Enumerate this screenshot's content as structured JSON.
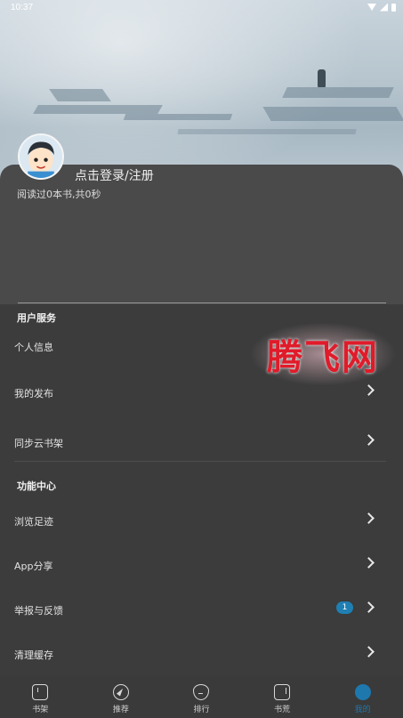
{
  "status_bar": {
    "time": "10:37"
  },
  "profile": {
    "login_label": "点击登录/注册",
    "read_stats": "阅读过0本书,共0秒"
  },
  "sections": {
    "user_services": {
      "title": "用户服务",
      "items": [
        {
          "label": "个人信息",
          "chevron": false
        },
        {
          "label": "我的发布",
          "chevron": true
        },
        {
          "label": "同步云书架",
          "chevron": true
        }
      ]
    },
    "function_center": {
      "title": "功能中心",
      "items": [
        {
          "label": "浏览足迹",
          "chevron": true
        },
        {
          "label": "App分享",
          "chevron": true
        },
        {
          "label": "举报与反馈",
          "chevron": true,
          "badge": "1"
        },
        {
          "label": "清理缓存",
          "chevron": true
        }
      ]
    }
  },
  "watermark": {
    "text": "腾飞网"
  },
  "bottom_nav": {
    "items": [
      {
        "label": "书架",
        "icon": "bookshelf-icon"
      },
      {
        "label": "推荐",
        "icon": "compass-icon"
      },
      {
        "label": "排行",
        "icon": "rank-icon"
      },
      {
        "label": "书荒",
        "icon": "book-icon"
      },
      {
        "label": "我的",
        "icon": "profile-icon",
        "active": true
      }
    ]
  },
  "colors": {
    "accent": "#1e78ae",
    "badge": "#1f7fb3",
    "watermark": "#e01b2a"
  }
}
